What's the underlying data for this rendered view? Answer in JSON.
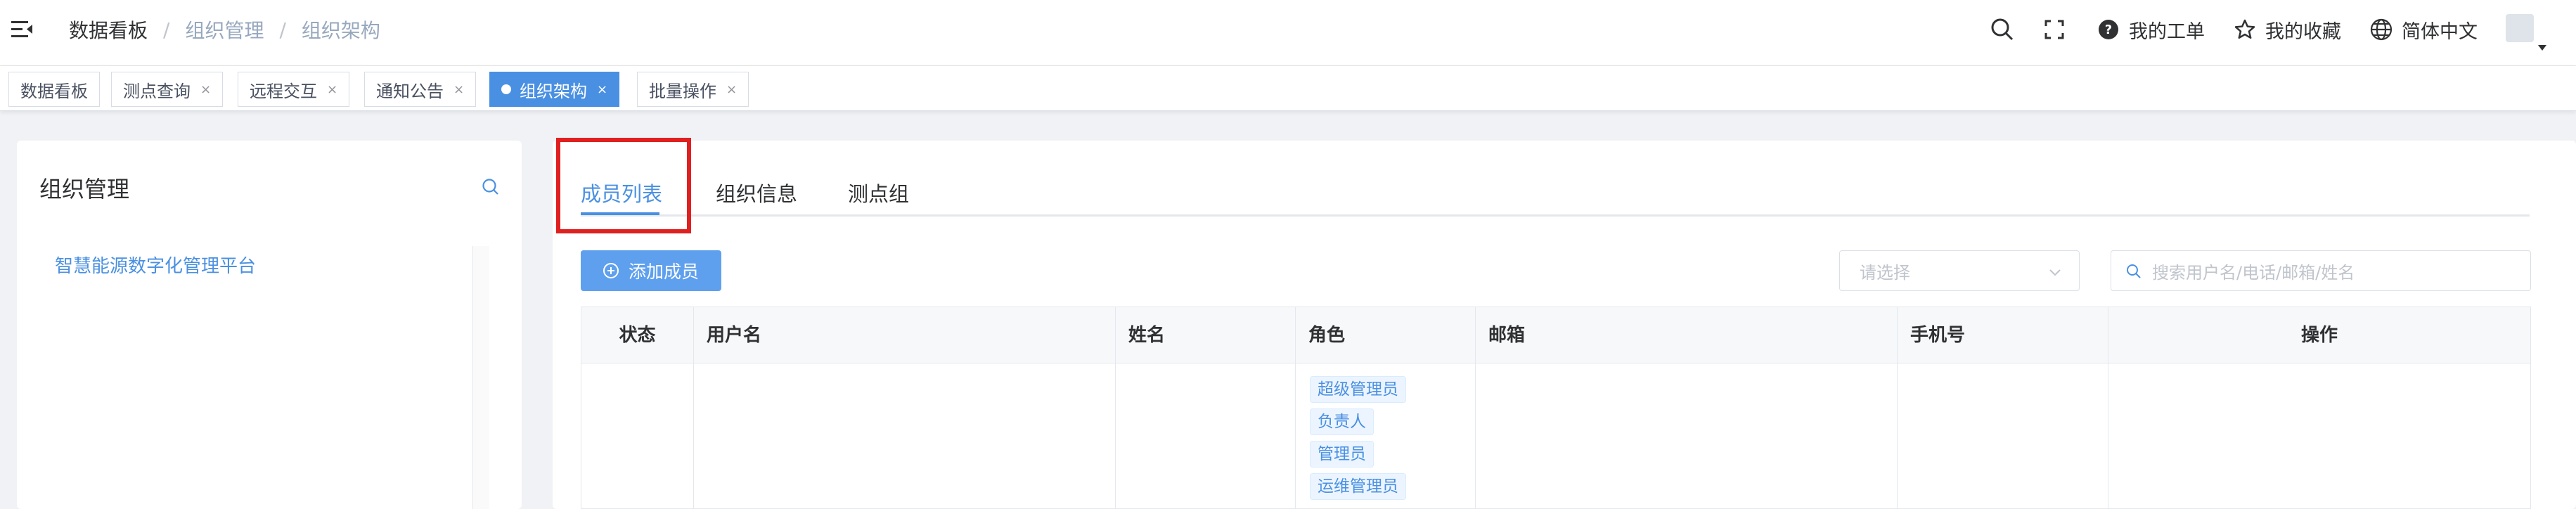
{
  "breadcrumb": {
    "item1": "数据看板",
    "item2": "组织管理",
    "item3": "组织架构",
    "sep": "/"
  },
  "header": {
    "my_tickets": "我的工单",
    "my_favorites": "我的收藏",
    "language": "简体中文"
  },
  "tags": {
    "t1": "数据看板",
    "t2": "测点查询",
    "t3": "远程交互",
    "t4": "通知公告",
    "t5": "组织架构",
    "t6": "批量操作",
    "close": "×"
  },
  "left_panel": {
    "title": "组织管理",
    "tree_root": "智慧能源数字化管理平台"
  },
  "tabs": {
    "members": "成员列表",
    "org_info": "组织信息",
    "point_group": "测点组"
  },
  "toolbar": {
    "add_member": "添加成员",
    "select_placeholder": "请选择",
    "search_placeholder": "搜索用户名/电话/邮箱/姓名"
  },
  "table": {
    "headers": {
      "status": "状态",
      "username": "用户名",
      "name": "姓名",
      "role": "角色",
      "email": "邮箱",
      "phone": "手机号",
      "actions": "操作"
    },
    "roles": [
      "超级管理员",
      "负责人",
      "管理员",
      "运维管理员"
    ]
  },
  "colors": {
    "accent": "#4a90e2",
    "highlight": "#e02020"
  }
}
